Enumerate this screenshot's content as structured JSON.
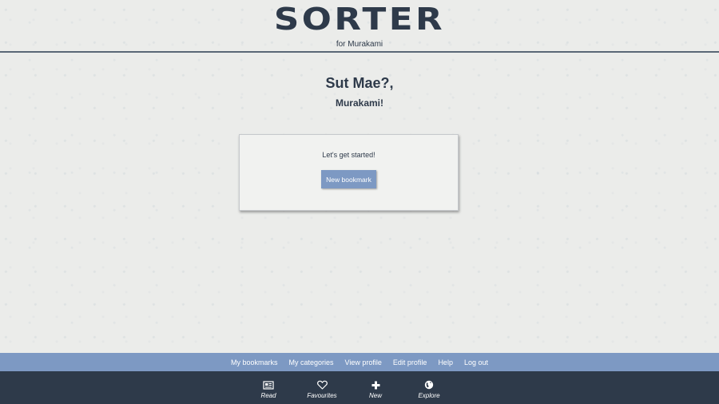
{
  "header": {
    "logo": "SORTER",
    "subtitle": "for Murakami"
  },
  "greeting": {
    "line1": "Sut Mae?,",
    "line2": "Murakami!"
  },
  "card": {
    "text": "Let's get started!",
    "button_label": "New bookmark"
  },
  "menu": {
    "items": [
      "My bookmarks",
      "My categories",
      "View profile",
      "Edit profile",
      "Help",
      "Log out"
    ]
  },
  "tabbar": {
    "items": [
      {
        "label": "Read",
        "icon": "newspaper-icon"
      },
      {
        "label": "Favourites",
        "icon": "heart-icon"
      },
      {
        "label": "New",
        "icon": "plus-icon"
      },
      {
        "label": "Explore",
        "icon": "globe-icon"
      }
    ]
  },
  "colors": {
    "dark": "#2e3a4a",
    "accent": "#7d99c3",
    "background": "#ebecea"
  }
}
